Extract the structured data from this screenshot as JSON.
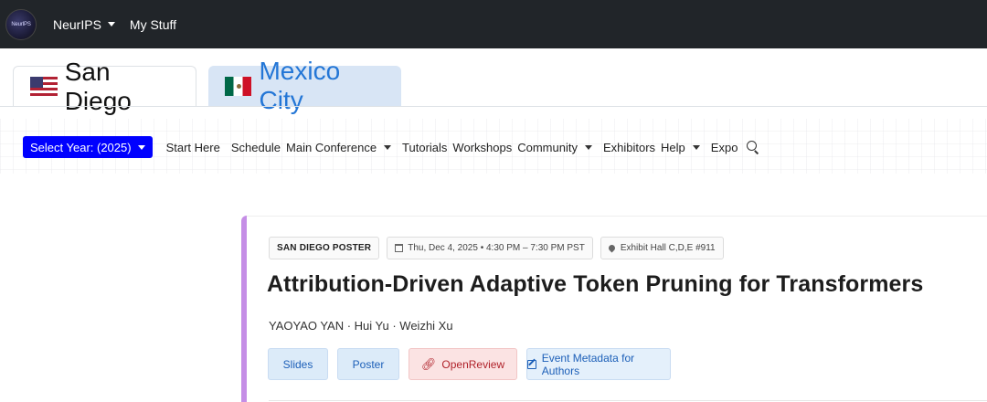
{
  "topbar": {
    "logo_text": "NeurIPS",
    "links": [
      {
        "label": "NeurIPS",
        "has_dropdown": true
      },
      {
        "label": "My Stuff",
        "has_dropdown": false
      }
    ]
  },
  "location_tabs": [
    {
      "label": "San Diego",
      "flag": "us-flag-icon",
      "active": true
    },
    {
      "label": "Mexico City",
      "flag": "mexico-flag-icon",
      "active": false
    }
  ],
  "mainnav": {
    "year_button": "Select Year: (2025)",
    "items": [
      {
        "label": "Start Here"
      },
      {
        "label": "Schedule"
      },
      {
        "label": "Main Conference"
      },
      {
        "label": "Tutorials"
      },
      {
        "label": "Workshops"
      },
      {
        "label": "Community"
      },
      {
        "label": "Exhibitors"
      },
      {
        "label": "Help"
      },
      {
        "label": "Expo"
      }
    ],
    "search_icon": "search-icon"
  },
  "event": {
    "type_badge": "SAN DIEGO POSTER",
    "datetime": "Thu, Dec 4, 2025 • 4:30 PM – 7:30 PM PST",
    "location": "Exhibit Hall C,D,E #911",
    "title": "Attribution-Driven Adaptive Token Pruning for Transformers",
    "authors": "YAOYAO YAN · Hui Yu · Weizhi Xu",
    "actions": {
      "slides": "Slides",
      "poster": "Poster",
      "openreview": "OpenReview",
      "metadata": "Event Metadata for Authors"
    }
  },
  "colors": {
    "topbar_bg": "#212529",
    "year_button_bg": "#0000ff",
    "card_accent": "#c58ee6",
    "link_blue": "#2376d6"
  }
}
